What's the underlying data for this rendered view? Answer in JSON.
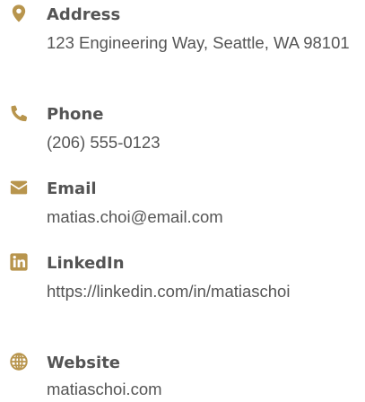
{
  "accent_color": "#b8954d",
  "contact": {
    "address": {
      "icon": "map-marker-icon",
      "label": "Address",
      "value": "123 Engineering Way, Seattle, WA 98101"
    },
    "phone": {
      "icon": "phone-icon",
      "label": "Phone",
      "value": "(206) 555-0123"
    },
    "email": {
      "icon": "envelope-icon",
      "label": "Email",
      "value": "matias.choi@email.com"
    },
    "linkedin": {
      "icon": "linkedin-icon",
      "label": "LinkedIn",
      "value": "https://linkedin.com/in/matiaschoi"
    },
    "website": {
      "icon": "globe-icon",
      "label": "Website",
      "value": "matiaschoi.com"
    }
  }
}
